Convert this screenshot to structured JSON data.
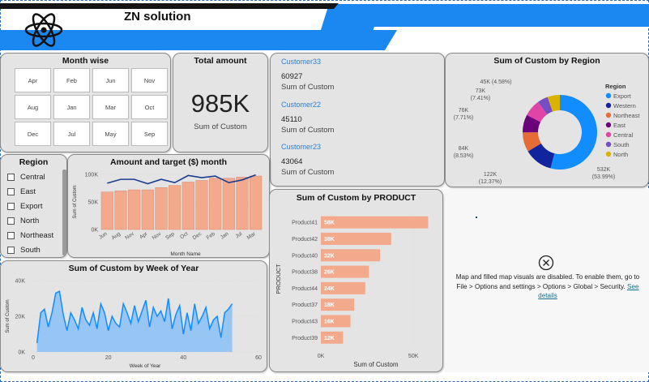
{
  "header": {
    "title": "ZN solution",
    "colors": {
      "blue": "#1a88f0",
      "dark": "#151515"
    }
  },
  "month_wise": {
    "title": "Month wise",
    "months": [
      "Apr",
      "Feb",
      "Jun",
      "Nov",
      "Aug",
      "Jan",
      "Mar",
      "Oct",
      "Dec",
      "Jul",
      "May",
      "Sep"
    ]
  },
  "total_amount": {
    "title": "Total amount",
    "value": "985K",
    "subtitle": "Sum of Custom"
  },
  "customers": [
    {
      "name": "Customer33",
      "value": "60927",
      "label": "Sum of Custom"
    },
    {
      "name": "Customer22",
      "value": "45110",
      "label": "Sum of Custom"
    },
    {
      "name": "Customer23",
      "value": "43064",
      "label": "Sum of Custom"
    }
  ],
  "region_slicer": {
    "title": "Region",
    "items": [
      "Central",
      "East",
      "Export",
      "North",
      "Northeast",
      "South"
    ]
  },
  "empty_map": {
    "message": "Map and filled map visuals are disabled. To enable them, go to File > Options and settings > Options > Global > Security.",
    "link": "See details"
  },
  "chart_data": [
    {
      "id": "region_donut",
      "type": "pie",
      "title": "Sum of Custom by Region",
      "legend_title": "Region",
      "legend_position": "right",
      "slices": [
        {
          "name": "Export",
          "value": 532,
          "label": "532K",
          "pct": "(53.99%)",
          "color": "#118dff"
        },
        {
          "name": "Western",
          "value": 122,
          "label": "122K",
          "pct": "(12.37%)",
          "color": "#12239e"
        },
        {
          "name": "Northeast",
          "value": 84,
          "label": "84K",
          "pct": "(8.53%)",
          "color": "#e66c37"
        },
        {
          "name": "East",
          "value": 76,
          "label": "76K",
          "pct": "(7.71%)",
          "color": "#6b007b"
        },
        {
          "name": "Central",
          "value": 73,
          "label": "73K",
          "pct": "(7.41%)",
          "color": "#e044a7"
        },
        {
          "name": "South",
          "value": 45,
          "label": "45K",
          "pct": "(4.58%)",
          "color": "#744ec2"
        },
        {
          "name": "North",
          "value": 53,
          "label": "",
          "pct": "",
          "color": "#d9b300"
        }
      ]
    },
    {
      "id": "amount_target",
      "type": "bar",
      "title": "Amount and target ($) month",
      "xlabel": "Month Name",
      "ylabel": "Sum of Custom",
      "ylim": [
        0,
        100000
      ],
      "yticks": [
        "0K",
        "50K",
        "100K"
      ],
      "categories": [
        "Jun",
        "Aug",
        "Nov",
        "Apr",
        "Nov",
        "Sep",
        "Oct",
        "Dec",
        "Feb",
        "Jan",
        "Jul",
        "Mar"
      ],
      "series": [
        {
          "type": "bar",
          "values": [
            68000,
            70000,
            72000,
            72000,
            76000,
            80000,
            86000,
            89000,
            93000,
            93000,
            95000,
            97000
          ],
          "color": "#f2a98c"
        },
        {
          "type": "line",
          "values": [
            84000,
            91000,
            91000,
            83000,
            91000,
            85000,
            98000,
            94000,
            97000,
            85000,
            90000,
            99000
          ],
          "color": "#1b3d8f"
        }
      ]
    },
    {
      "id": "by_product",
      "type": "bar",
      "orientation": "horizontal",
      "title": "Sum of Custom by PRODUCT",
      "xlabel": "Sum of Custom",
      "ylabel": "PRODUCT",
      "xlim": [
        0,
        60000
      ],
      "xticks": [
        "0K",
        "50K"
      ],
      "categories": [
        "Product41",
        "Product42",
        "Product40",
        "Product38",
        "Product44",
        "Product37",
        "Product43",
        "Product39"
      ],
      "values": [
        58000,
        38000,
        32000,
        26000,
        24000,
        18000,
        16000,
        12000
      ],
      "data_labels": [
        "58K",
        "38K",
        "32K",
        "26K",
        "24K",
        "18K",
        "16K",
        "12K"
      ],
      "color": "#f2a98c"
    },
    {
      "id": "by_week",
      "type": "area",
      "title": "Sum of Custom by Week of Year",
      "xlabel": "Week of Year",
      "ylabel": "Sum of Custom",
      "xlim": [
        0,
        60
      ],
      "ylim": [
        0,
        40000
      ],
      "xticks": [
        "0",
        "20",
        "40",
        "60"
      ],
      "yticks": [
        "0K",
        "20K",
        "40K"
      ],
      "x": [
        1,
        2,
        3,
        4,
        5,
        6,
        7,
        8,
        9,
        10,
        11,
        12,
        13,
        14,
        15,
        16,
        17,
        18,
        19,
        20,
        21,
        22,
        23,
        24,
        25,
        26,
        27,
        28,
        29,
        30,
        31,
        32,
        33,
        34,
        35,
        36,
        37,
        38,
        39,
        40,
        41,
        42,
        43,
        44,
        45,
        46,
        47,
        48,
        49,
        50,
        51,
        52,
        53
      ],
      "values": [
        5000,
        22000,
        24000,
        14000,
        22000,
        33000,
        34000,
        21000,
        12000,
        22000,
        18000,
        13000,
        25000,
        18000,
        15000,
        22000,
        13000,
        27000,
        22000,
        12000,
        20000,
        16000,
        14000,
        27000,
        22000,
        16000,
        26000,
        17000,
        23000,
        29000,
        14000,
        25000,
        20000,
        23000,
        17000,
        30000,
        13000,
        21000,
        26000,
        10000,
        22000,
        12000,
        27000,
        16000,
        20000,
        25000,
        13000,
        18000,
        20000,
        8000,
        22000,
        24000,
        27000
      ],
      "color": "#118dff"
    }
  ]
}
